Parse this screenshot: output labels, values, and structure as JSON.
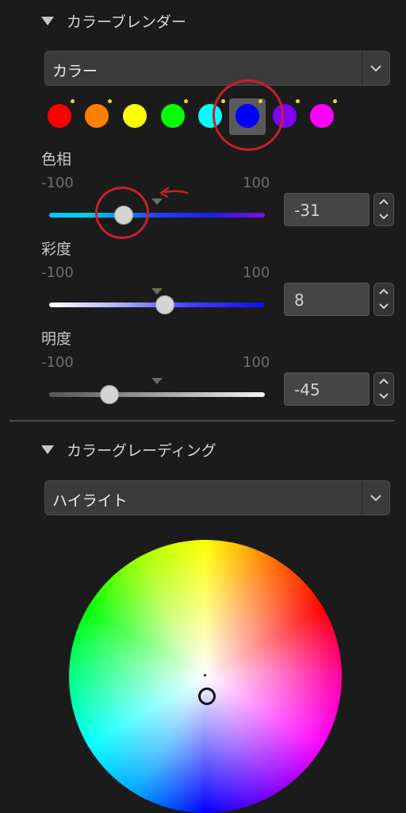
{
  "color_blender": {
    "title": "カラーブレンダー",
    "mode": {
      "selected": "カラー"
    },
    "swatches": [
      {
        "name": "red",
        "color": "#ff0000",
        "adjusted": true
      },
      {
        "name": "orange",
        "color": "#ff7f00",
        "adjusted": true
      },
      {
        "name": "yellow",
        "color": "#ffff00",
        "adjusted": false
      },
      {
        "name": "green",
        "color": "#00ff00",
        "adjusted": true
      },
      {
        "name": "aqua",
        "color": "#00ffff",
        "adjusted": true
      },
      {
        "name": "blue",
        "color": "#0000ff",
        "adjusted": true,
        "selected": true
      },
      {
        "name": "purple",
        "color": "#8000ff",
        "adjusted": true
      },
      {
        "name": "magenta",
        "color": "#ff00ff",
        "adjusted": true
      }
    ],
    "hue": {
      "label": "色相",
      "min": "-100",
      "max": "100",
      "value": "-31"
    },
    "saturation": {
      "label": "彩度",
      "min": "-100",
      "max": "100",
      "value": "8"
    },
    "lightness": {
      "label": "明度",
      "min": "-100",
      "max": "100",
      "value": "-45"
    }
  },
  "color_grading": {
    "title": "カラーグレーディング",
    "range": {
      "selected": "ハイライト"
    }
  },
  "colors": {
    "annotation": "#c8202a",
    "accent": "#f2d33a"
  }
}
